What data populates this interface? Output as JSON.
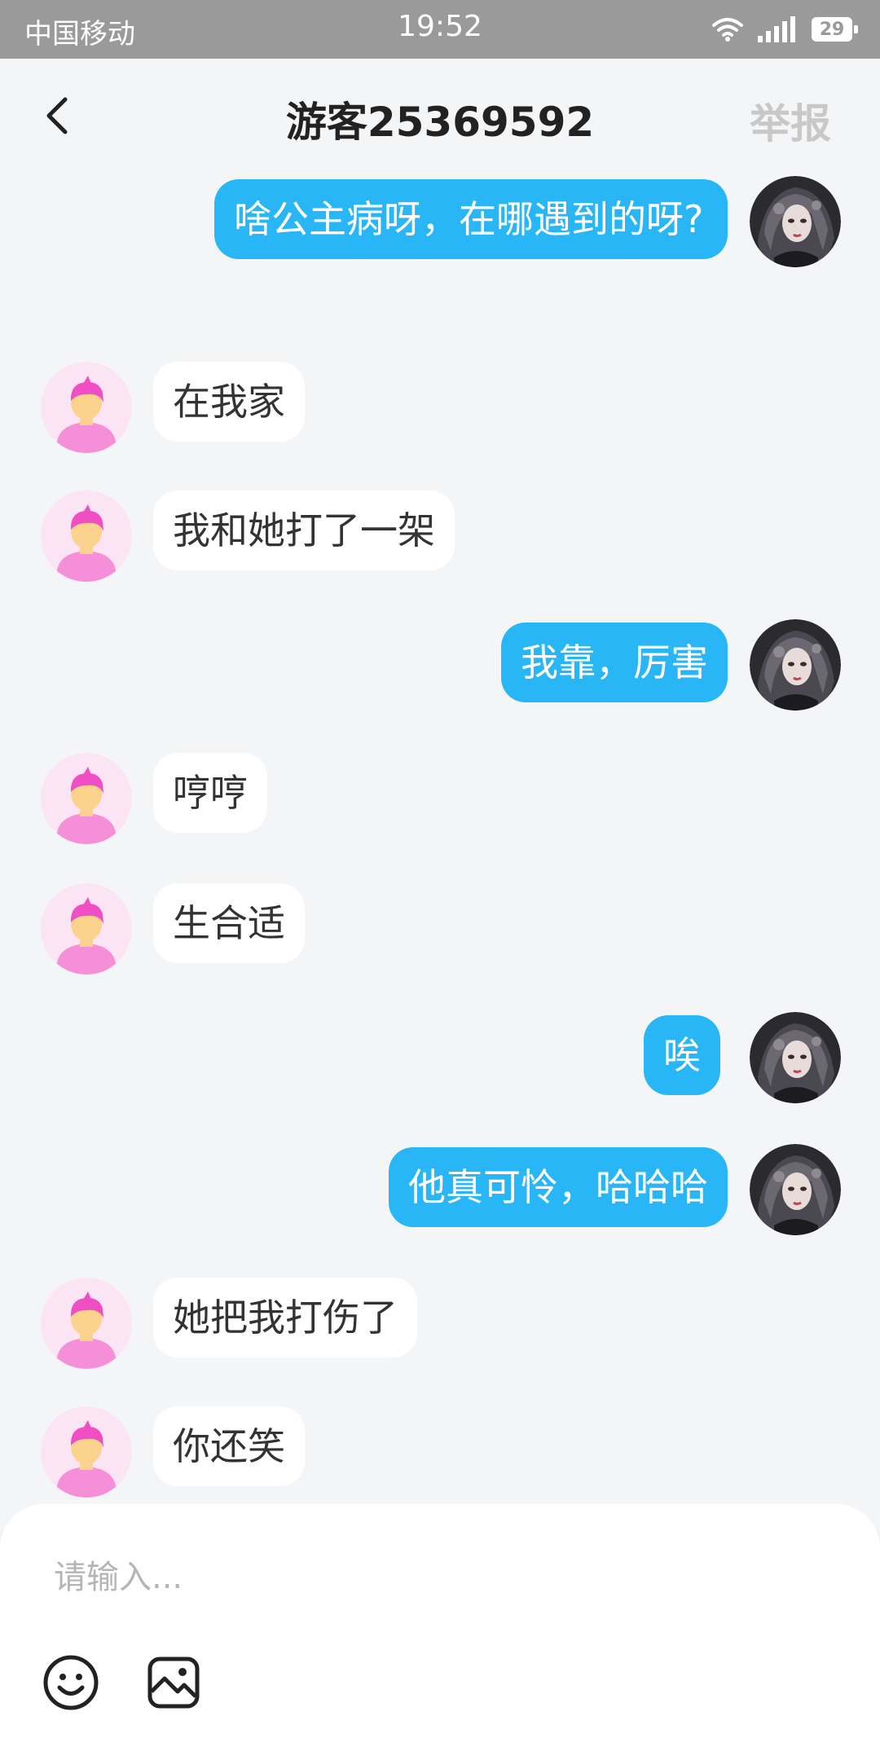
{
  "status_bar": {
    "carrier": "中国移动",
    "time": "19:52",
    "battery": "29",
    "icons": [
      "wifi-icon",
      "signal-icon",
      "battery-icon"
    ]
  },
  "header": {
    "title": "游客25369592",
    "report_label": "举报",
    "back_icon": "chevron-left-icon"
  },
  "messages": [
    {
      "side": "right",
      "text": "啥公主病呀，在哪遇到的呀?"
    },
    {
      "side": "left",
      "text": "在我家"
    },
    {
      "side": "left",
      "text": "我和她打了一架"
    },
    {
      "side": "right",
      "text": "我靠，厉害"
    },
    {
      "side": "left",
      "text": "哼哼"
    },
    {
      "side": "left",
      "text": "生合适"
    },
    {
      "side": "right",
      "text": "唉"
    },
    {
      "side": "right",
      "text": "他真可怜，哈哈哈"
    },
    {
      "side": "left",
      "text": "她把我打伤了"
    },
    {
      "side": "left",
      "text": "你还笑"
    }
  ],
  "composer": {
    "placeholder": "请输入...",
    "emoji_icon": "smiley-icon",
    "image_icon": "image-icon"
  },
  "colors": {
    "accent": "#29b6f6",
    "background": "#f4f5f7",
    "status_bar": "#9a9a9a",
    "report_text": "#c8c8c8"
  }
}
